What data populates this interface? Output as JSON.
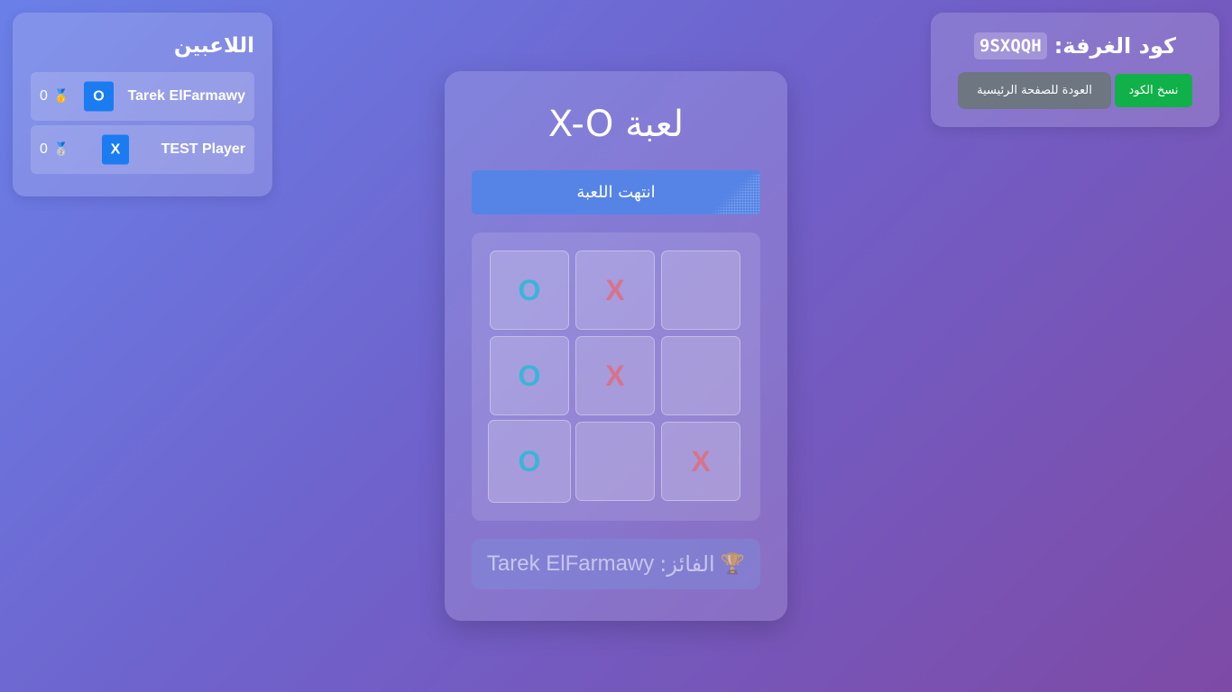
{
  "room": {
    "label": "كود الغرفة:",
    "code": "9SXQQH",
    "copy_button": "نسخ الكود",
    "home_button": "العودة للصفحة الرئيسية"
  },
  "players": {
    "title": "اللاعبين",
    "items": [
      {
        "name": "Tarek ElFarmawy",
        "symbol": "O",
        "medal": "🥇",
        "score": "0"
      },
      {
        "name": "TEST Player",
        "symbol": "X",
        "medal": "🥈",
        "score": "0"
      }
    ]
  },
  "game": {
    "title": "لعبة X-O",
    "status": "انتهت اللعبة",
    "board": [
      "O",
      "X",
      "",
      "O",
      "X",
      "",
      "O",
      "",
      "X"
    ],
    "winner_label": "الفائز:",
    "winner_name": "Tarek ElFarmawy",
    "winner_icon": "🏆"
  },
  "colors": {
    "o_mark": "#3db4d6",
    "x_mark": "#d7738d",
    "badge": "#1a7cf0",
    "copy_button": "#10b148",
    "home_button": "#6d7681",
    "status_bar": "#5584e6"
  }
}
